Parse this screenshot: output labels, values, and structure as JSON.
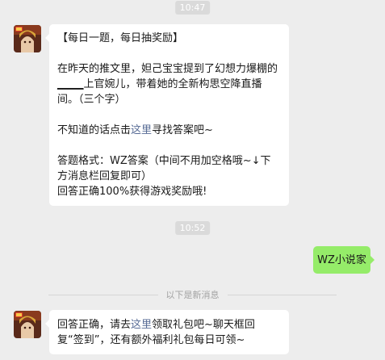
{
  "chat": {
    "timestamp_1": "10:47",
    "message_1": {
      "line_1": "【每日一题，每日抽奖励】",
      "line_2a": "在昨天的推文里，妲己宝宝提到了幻想力爆棚的",
      "blank": "_____",
      "line_2b": "上官婉儿，带着她的全新构思空降直播间。（三个字）",
      "line_3a": "不知道的话点击",
      "line_3_link": "这里",
      "line_3b": "寻找答案吧~",
      "line_4": "答题格式：WZ答案（中间不用加空格哦~↓下方消息栏回复即可）",
      "line_5": "回答正确100%获得游戏奖励哦!"
    },
    "timestamp_2": "10:52",
    "user_reply": "WZ小说家",
    "new_messages_divider": "以下是新消息",
    "message_2": {
      "text_a": "回答正确，请去",
      "link": "这里",
      "text_b": "领取礼包吧~聊天框回复“签到”，还有额外福利礼包每日可领~"
    }
  },
  "colors": {
    "background": "#ededed",
    "bubble_left": "#ffffff",
    "bubble_right": "#95ec69",
    "link": "#576b95"
  },
  "icons": {
    "avatar": "game-hero-avatar"
  }
}
